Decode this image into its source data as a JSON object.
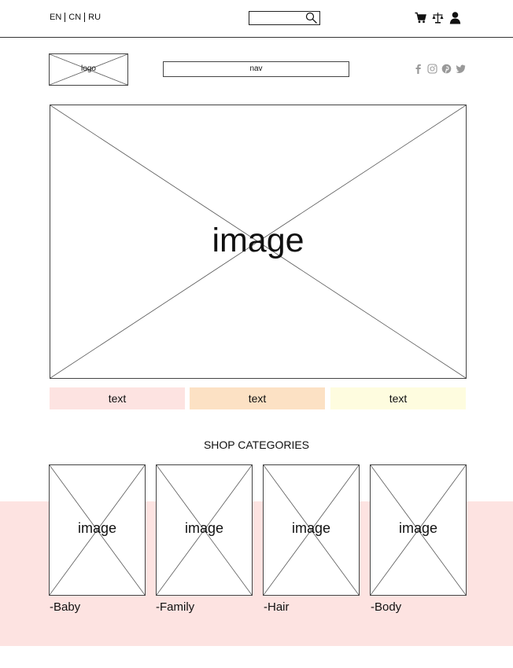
{
  "top_bar": {
    "languages": [
      "EN",
      "CN",
      "RU"
    ],
    "search": {
      "placeholder": "",
      "value": ""
    },
    "icons": [
      "cart-icon",
      "scales-icon",
      "user-icon"
    ]
  },
  "header": {
    "logo_label": "logo",
    "nav_label": "nav",
    "social_icons": [
      "facebook-icon",
      "instagram-icon",
      "pinterest-icon",
      "twitter-icon"
    ]
  },
  "hero": {
    "label": "image"
  },
  "promo": [
    {
      "text": "text",
      "color": "#fde3e1"
    },
    {
      "text": "text",
      "color": "#fce1c4"
    },
    {
      "text": "text",
      "color": "#fefcdf"
    }
  ],
  "categories": {
    "title": "SHOP CATEGORIES",
    "band_color": "#fde3e1",
    "items": [
      {
        "image_label": "image",
        "label": "-Baby"
      },
      {
        "image_label": "image",
        "label": "-Family"
      },
      {
        "image_label": "image",
        "label": "-Hair"
      },
      {
        "image_label": "image",
        "label": "-Body"
      }
    ]
  }
}
